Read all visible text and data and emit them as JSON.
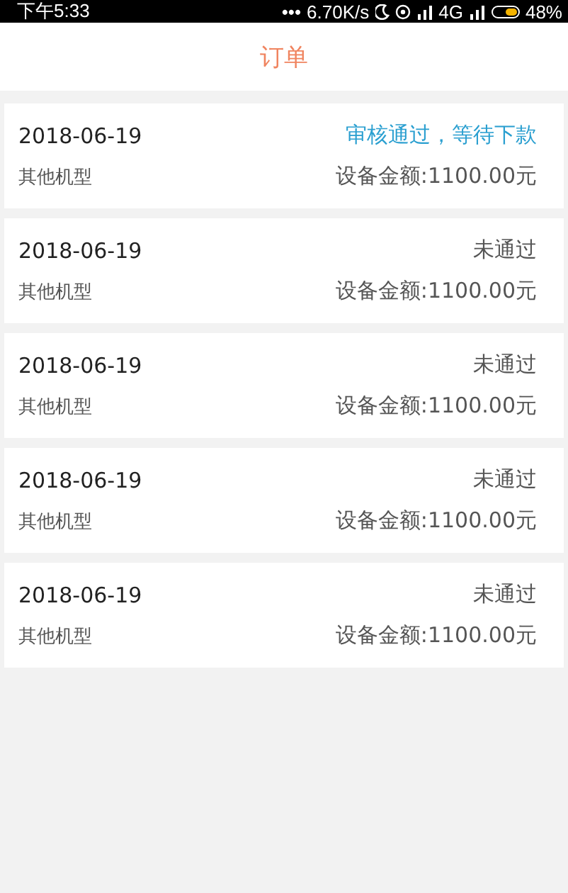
{
  "status_bar": {
    "time": "下午5:33",
    "dots": "•••",
    "speed": "6.70K/s",
    "network": "4G",
    "battery_text": "48%"
  },
  "header": {
    "title": "订单"
  },
  "orders": [
    {
      "date": "2018-06-19",
      "status": "审核通过，等待下款",
      "kind": "approved",
      "model": "其他机型",
      "amount": "设备金额:1100.00元"
    },
    {
      "date": "2018-06-19",
      "status": "未通过",
      "kind": "rejected",
      "model": "其他机型",
      "amount": "设备金额:1100.00元"
    },
    {
      "date": "2018-06-19",
      "status": "未通过",
      "kind": "rejected",
      "model": "其他机型",
      "amount": "设备金额:1100.00元"
    },
    {
      "date": "2018-06-19",
      "status": "未通过",
      "kind": "rejected",
      "model": "其他机型",
      "amount": "设备金额:1100.00元"
    },
    {
      "date": "2018-06-19",
      "status": "未通过",
      "kind": "rejected",
      "model": "其他机型",
      "amount": "设备金额:1100.00元"
    }
  ]
}
